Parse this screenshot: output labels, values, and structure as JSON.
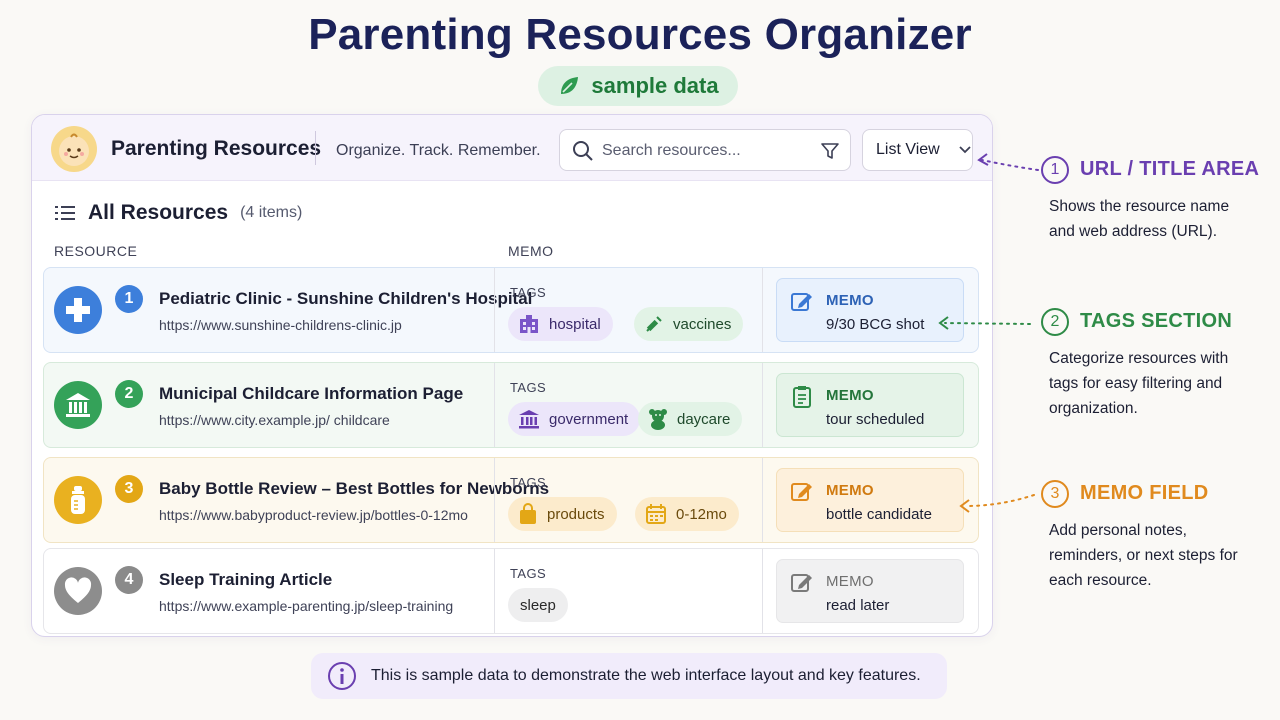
{
  "title": "Parenting Resources Organizer",
  "sample_label": "sample data",
  "header": {
    "app_name": "Parenting Resources",
    "tagline": "Organize. Track. Remember.",
    "search_placeholder": "Search resources...",
    "view_select": "List View"
  },
  "list": {
    "heading": "All Resources",
    "count": "(4 items)",
    "col_resource": "RESOURCE",
    "col_memo": "MEMO",
    "tags_label": "TAGS",
    "memo_label": "MEMO"
  },
  "rows": [
    {
      "num": "1",
      "icon": "medical-cross-icon",
      "title": "Pediatric Clinic - Sunshine Children's Hospital",
      "url": "https://www.sunshine-childrens-clinic.jp",
      "tags": [
        {
          "label": "hospital",
          "icon": "hospital-building-icon"
        },
        {
          "label": "vaccines",
          "icon": "syringe-icon"
        }
      ],
      "memo": "9/30 BCG shot",
      "accent": "#3a78d4"
    },
    {
      "num": "2",
      "icon": "government-building-icon",
      "title": "Municipal Childcare Information Page",
      "url": "https://www.city.example.jp/ childcare",
      "tags": [
        {
          "label": "government",
          "icon": "government-building-icon"
        },
        {
          "label": "daycare",
          "icon": "teddy-bear-icon"
        }
      ],
      "memo": "tour scheduled",
      "accent": "#2e9b50"
    },
    {
      "num": "3",
      "icon": "baby-bottle-icon",
      "title": "Baby Bottle Review – Best Bottles for Newborns",
      "url": "https://www.babyproduct-review.jp/bottles-0-12mo",
      "tags": [
        {
          "label": "products",
          "icon": "shopping-bag-icon"
        },
        {
          "label": "0-12mo",
          "icon": "calendar-icon"
        }
      ],
      "memo": "bottle candidate",
      "accent": "#e0a818"
    },
    {
      "num": "4",
      "icon": "heart-icon",
      "title": "Sleep Training Article",
      "url": "https://www.example-parenting.jp/sleep-training",
      "tags": [
        {
          "label": "sleep",
          "icon": ""
        }
      ],
      "memo": "read later",
      "accent": "#8a8a8a"
    }
  ],
  "callouts": [
    {
      "num": "1",
      "head": "URL / TITLE AREA",
      "desc": "Shows the resource name and web address (URL).",
      "color": "#6a3fb0"
    },
    {
      "num": "2",
      "head": "TAGS SECTION",
      "desc": "Categorize resources with tags for easy filtering and organization.",
      "color": "#2e8b47"
    },
    {
      "num": "3",
      "head": "MEMO FIELD",
      "desc": "Add personal notes, reminders, or next steps for each resource.",
      "color": "#e08a1e"
    }
  ],
  "footnote": "This is sample data to demonstrate the web interface layout and key features."
}
